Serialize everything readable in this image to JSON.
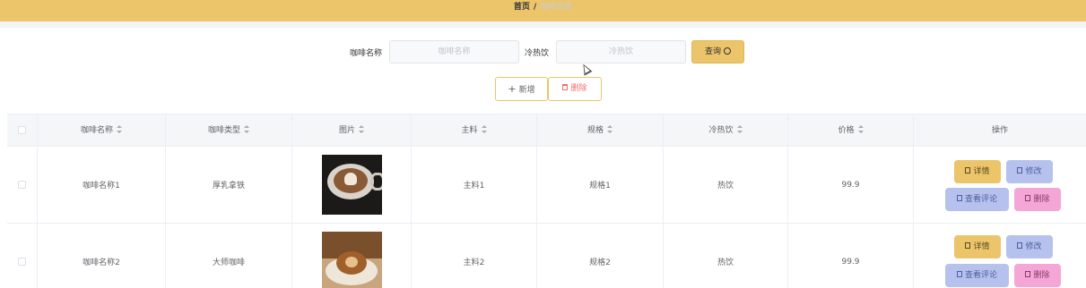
{
  "breadcrumb": {
    "home": "首页",
    "separator": "/",
    "current": "咖啡信息"
  },
  "search": {
    "name_label": "咖啡名称",
    "name_placeholder": "咖啡名称",
    "name_value": "",
    "temp_label": "冷热饮",
    "temp_placeholder": "冷热饮",
    "temp_value": "",
    "query_label": "查询",
    "query_icon": "search-icon"
  },
  "actions": {
    "add_label": "新增",
    "delete_label": "删除"
  },
  "table": {
    "columns": [
      "咖啡名称",
      "咖啡类型",
      "图片",
      "主料",
      "规格",
      "冷热饮",
      "价格",
      "操作"
    ],
    "rows": [
      {
        "name": "咖啡名称1",
        "type": "厚乳拿铁",
        "image": "latte-art-photo",
        "main": "主料1",
        "spec": "规格1",
        "temp": "热饮",
        "price": "99.9"
      },
      {
        "name": "咖啡名称2",
        "type": "大师咖啡",
        "image": "cappuccino-photo",
        "main": "主料2",
        "spec": "规格2",
        "temp": "热饮",
        "price": "99.9"
      }
    ],
    "row_actions": {
      "detail": "详情",
      "edit": "修改",
      "comments": "查看评论",
      "delete": "删除"
    }
  },
  "colors": {
    "accent": "#ecc46a",
    "edit": "#b6c1ee",
    "danger": "#f4a6d6"
  }
}
